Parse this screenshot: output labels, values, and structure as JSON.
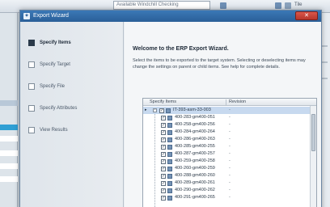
{
  "background": {
    "field_text": "Available Windchill Checking",
    "toolbar_label": "Tile"
  },
  "window": {
    "title": "Export Wizard",
    "close_symbol": "✕"
  },
  "steps": [
    {
      "label": "Specify Items",
      "active": true
    },
    {
      "label": "Specify Target",
      "active": false
    },
    {
      "label": "Specify File",
      "active": false
    },
    {
      "label": "Specify Attributes",
      "active": false
    },
    {
      "label": "View Results",
      "active": false
    }
  ],
  "content": {
    "heading": "Welcome to the ERP Export Wizard.",
    "description": "Select the items to be exported to the target system. Selecting or deselecting items may change the settings on parent or child items. See help for complete details."
  },
  "grid": {
    "columns": [
      "Specify Items",
      "Revision"
    ],
    "root": {
      "name": "IT-393-asm-33-003",
      "revision": "-"
    },
    "children": [
      {
        "name": "400-283-gm400-051",
        "revision": "-"
      },
      {
        "name": "400-258-gm400-256",
        "revision": "-"
      },
      {
        "name": "400-284-gm400-264",
        "revision": "-"
      },
      {
        "name": "400-286-gm400-263",
        "revision": "-"
      },
      {
        "name": "400-285-gm400-255",
        "revision": "-"
      },
      {
        "name": "400-287-gm400-257",
        "revision": "-"
      },
      {
        "name": "400-259-gm400-258",
        "revision": "-"
      },
      {
        "name": "400-260-gm400-259",
        "revision": "-"
      },
      {
        "name": "400-288-gm400-260",
        "revision": "-"
      },
      {
        "name": "400-289-gm400-261",
        "revision": "-"
      },
      {
        "name": "400-290-gm400-262",
        "revision": "-"
      },
      {
        "name": "400-291-gm400-265",
        "revision": "-"
      }
    ]
  },
  "colors": {
    "titlebar": "#2a5f98",
    "selection": "#c7d9ef",
    "close": "#c8443a"
  }
}
